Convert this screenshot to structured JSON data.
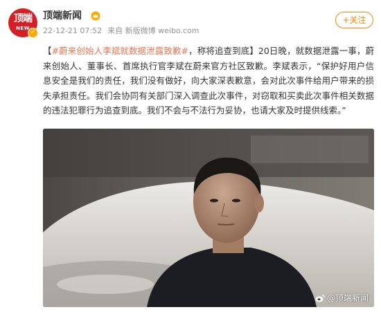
{
  "author": {
    "name": "顶端新闻",
    "avatar_text": "顶端",
    "avatar_subtext": "NEW"
  },
  "meta": {
    "time": "22-12-21 07:52",
    "source": "来自 新版微博 weibo.com"
  },
  "follow_label": "+关注",
  "post": {
    "topic": "#蔚来创始人李斌就数据泄露致歉#",
    "text": "，称将追查到底】20日晚，就数据泄露一事，蔚来创始人、董事长、首席执行官李斌在蔚来官方社区致歉。李斌表示，“保护好用户信息安全是我们的责任，我们没有做好，向大家深表歉意，会对此次事件给用户带来的损失承担责任。我们会协同有关部门深入调查此次事件，对窃取和买卖此次事件相关数据的违法犯罪行为追查到底。我们不会与不法行为妥协，也请大家及时提供线索。”",
    "open_bracket": "【"
  },
  "image": {
    "watermark": "@顶端新闻"
  },
  "colors": {
    "accent": "#ff8200",
    "topic": "#eb7350",
    "brand_red": "#d51f26"
  }
}
